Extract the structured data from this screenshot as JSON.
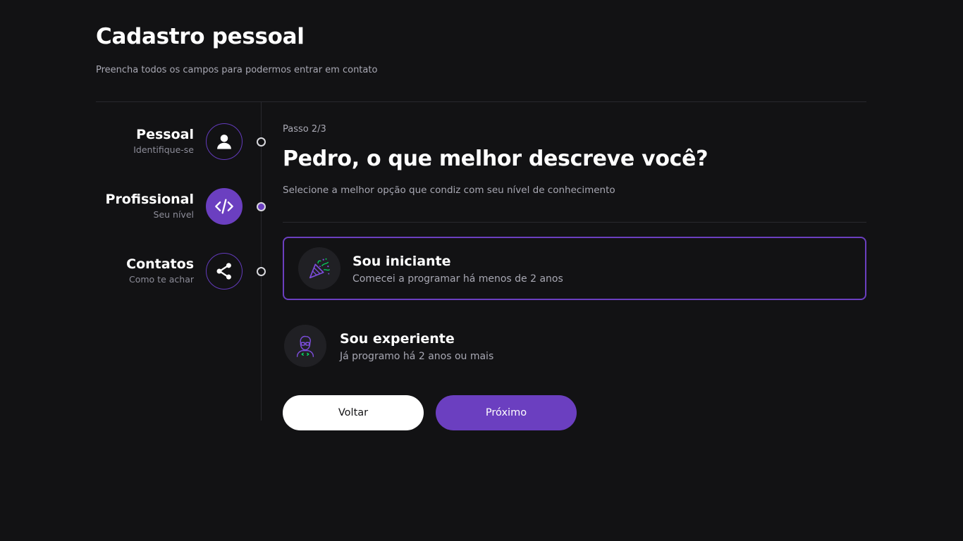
{
  "header": {
    "title": "Cadastro pessoal",
    "subtitle": "Preencha todos os campos para podermos entrar em contato"
  },
  "steps": [
    {
      "title": "Pessoal",
      "desc": "Identifique-se",
      "icon": "user-icon",
      "active": false
    },
    {
      "title": "Profissional",
      "desc": "Seu nível",
      "icon": "code-icon",
      "active": true
    },
    {
      "title": "Contatos",
      "desc": "Como te achar",
      "icon": "share-icon",
      "active": false
    }
  ],
  "main": {
    "step_counter": "Passo 2/3",
    "question": "Pedro, o que melhor descreve você?",
    "question_desc": "Selecione a melhor opção que condiz com seu nível de conhecimento",
    "options": [
      {
        "title": "Sou iniciante",
        "desc": "Comecei a programar há menos de 2 anos",
        "icon": "party-popper-icon",
        "selected": true
      },
      {
        "title": "Sou experiente",
        "desc": "Já programo há 2 anos ou mais",
        "icon": "developer-icon",
        "selected": false
      }
    ]
  },
  "buttons": {
    "back_label": "Voltar",
    "next_label": "Próximo"
  },
  "colors": {
    "background": "#121214",
    "accent": "#6b3fc0",
    "divider": "#29292e",
    "text_muted": "#a8a8b3"
  }
}
